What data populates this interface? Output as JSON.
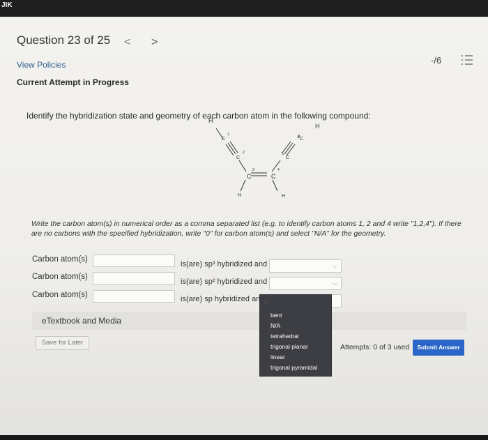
{
  "topbar": {
    "text": "JIK"
  },
  "question": {
    "title": "Question 23 of 25",
    "prev_symbol": "<",
    "next_symbol": ">",
    "score": "-/6"
  },
  "links": {
    "view_policies": "View Policies"
  },
  "attempt": {
    "heading": "Current Attempt in Progress"
  },
  "prompt": "Identify the hybridization state and geometry of each carbon atom in the following compound:",
  "molecule": {
    "atoms": [
      "H",
      "C",
      "C",
      "C",
      "C",
      "C",
      "C",
      "H",
      "H",
      "H"
    ],
    "numbers": [
      "1",
      "2",
      "3",
      "4",
      "5",
      "6"
    ]
  },
  "instructions": "Write the carbon atom(s) in numerical order as a comma separated list (e.g. to identify carbon atoms 1, 2 and 4 write \"1,2,4\"). If there are no carbons with the specified hybridization, write \"0\" for carbon atom(s) and select \"N/A\" for the geometry.",
  "rows": [
    {
      "label": "Carbon atom(s)",
      "text": "is(are) sp³ hybridized and"
    },
    {
      "label": "Carbon atom(s)",
      "text": "is(are) sp² hybridized and"
    },
    {
      "label": "Carbon atom(s)",
      "text": "is(are) sp hybridized and"
    }
  ],
  "dropdown_check": "✓",
  "dropdown_options": [
    "bent",
    "N/A",
    "tetrahedral",
    "trigonal planar",
    "linear",
    "trigonal pyramidal"
  ],
  "etextbook": "eTextbook and Media",
  "buttons": {
    "save": "Save for Later",
    "submit": "Submit Answer"
  },
  "attempts": "Attempts: 0 of 3 used",
  "icons": {
    "prev": "chevron-left-icon",
    "next": "chevron-right-icon",
    "list": "list-icon",
    "select": "chevron-down-icon"
  },
  "colors": {
    "link": "#2e5f8f",
    "submit": "#2a66c7",
    "dropdown_bg": "#3d3e43"
  }
}
